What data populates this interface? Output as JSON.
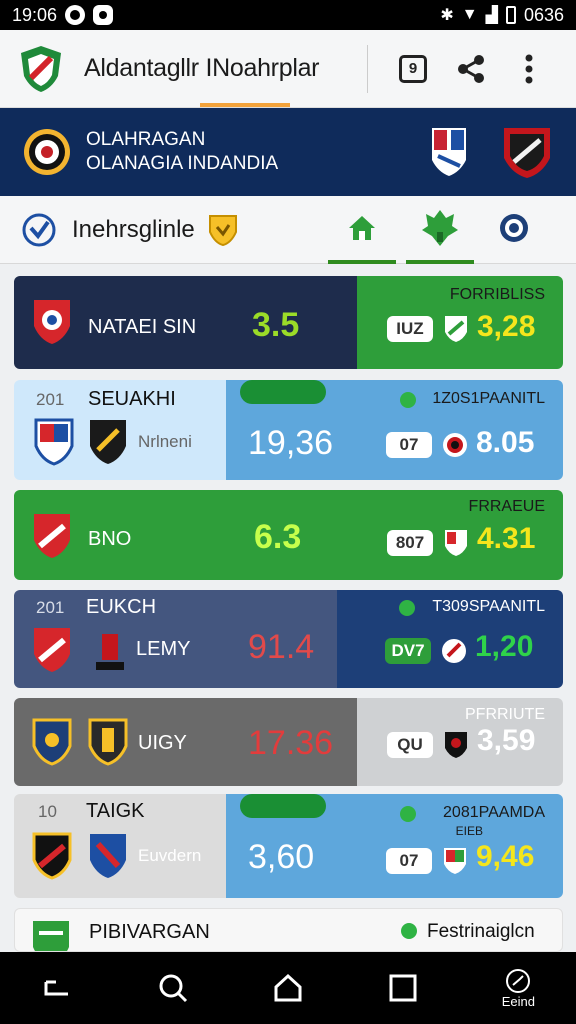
{
  "status_bar": {
    "time": "19:06",
    "right_time": "0636"
  },
  "app_bar": {
    "title": "Aldantagllr INoahrplar",
    "square_btn_label": "9"
  },
  "banner": {
    "line1": "OLAHRAGAN",
    "line2": "OLANAGIA INDANDIA"
  },
  "filter": {
    "label": "Inehrsglinle"
  },
  "cards": [
    {
      "team": "NATAEI SIN",
      "score": "3.5",
      "header": "FORRIBLISS",
      "pill": "IUZ",
      "odds": "3,28"
    },
    {
      "small": "201",
      "team": "SEUAKHI",
      "sub": "Nrlneni",
      "score": "19,36",
      "header": "1Z0S1PAANITL",
      "pill": "07",
      "odds": "8.05"
    },
    {
      "team": "BNO",
      "score": "6.3",
      "header": "FRRAEUE",
      "pill": "807",
      "odds": "4.31"
    },
    {
      "small": "201",
      "team": "EUKCH",
      "sub": "LEMY",
      "score": "91.4",
      "header": "T309SPAANITL",
      "pill": "DV7",
      "odds": "1,20"
    },
    {
      "team": "UIGY",
      "score": "17.36",
      "header": "PFRRIUTE",
      "pill": "QU",
      "odds": "3,59"
    },
    {
      "small": "10",
      "team": "TAIGK",
      "sub": "Euvdern",
      "score": "3,60",
      "header": "2081PAAMDA",
      "header2": "EIEB",
      "pill": "07",
      "odds": "9,46"
    },
    {
      "team": "PIBIVARGAN",
      "header": "Festrinaiglcn"
    }
  ],
  "bottom_nav": {
    "last_label": "Eeind"
  },
  "colors": {
    "navy": "#0f2b5b",
    "green": "#2e9e3a",
    "lime": "#9bdc28"
  }
}
